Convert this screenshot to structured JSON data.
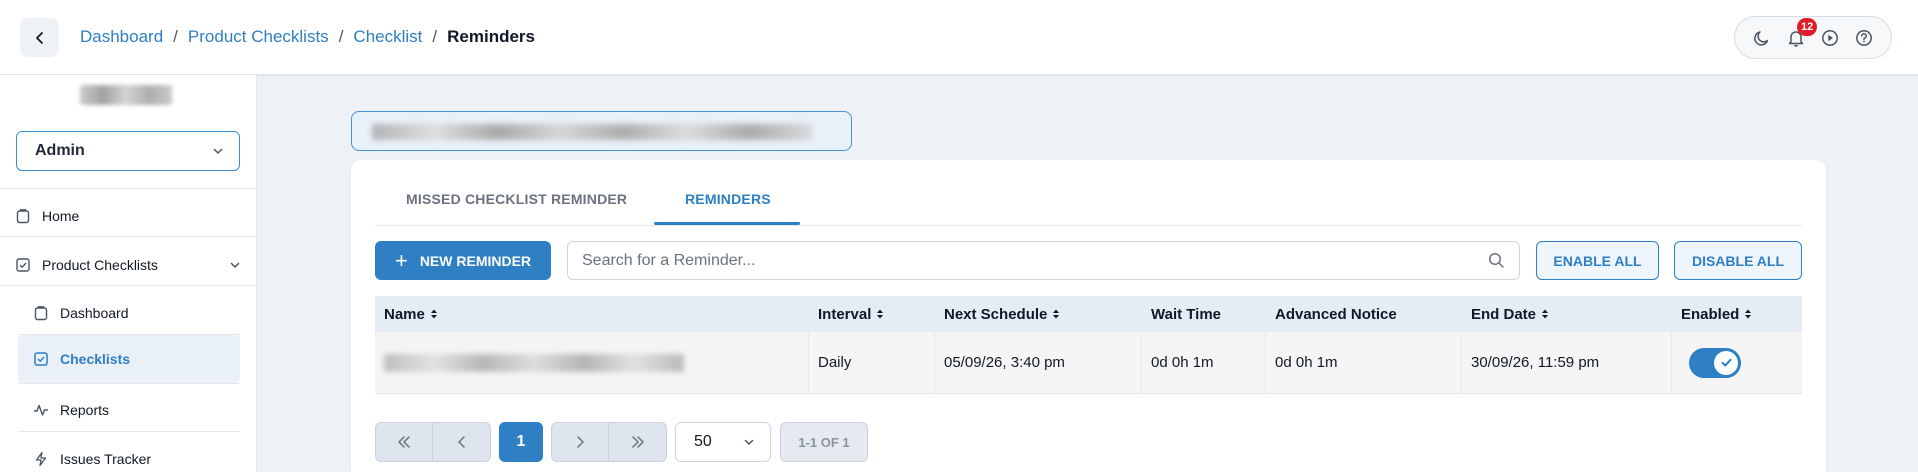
{
  "header": {
    "breadcrumb": {
      "items": [
        "Dashboard",
        "Product Checklists",
        "Checklist"
      ],
      "separator": "/",
      "current": "Reminders"
    },
    "notifications_count": "12",
    "tools": [
      "moon-icon",
      "bell-icon",
      "play-icon",
      "help-icon"
    ]
  },
  "sidebar": {
    "role": "Admin",
    "nav": {
      "home": "Home",
      "product_checklists": "Product Checklists",
      "dashboard": "Dashboard",
      "checklists": "Checklists",
      "reports": "Reports",
      "issues_tracker": "Issues Tracker"
    }
  },
  "main": {
    "tabs": {
      "missed": "MISSED CHECKLIST REMINDER",
      "reminders": "REMINDERS"
    },
    "toolbar": {
      "new_reminder": "NEW REMINDER",
      "search_placeholder": "Search for a Reminder...",
      "enable_all": "ENABLE ALL",
      "disable_all": "DISABLE ALL"
    },
    "table": {
      "columns": {
        "name": "Name",
        "interval": "Interval",
        "next_schedule": "Next Schedule",
        "wait_time": "Wait Time",
        "advanced_notice": "Advanced Notice",
        "end_date": "End Date",
        "enabled": "Enabled"
      },
      "rows": [
        {
          "interval": "Daily",
          "next_schedule": "05/09/26, 3:40 pm",
          "wait_time": "0d 0h 1m",
          "advanced_notice": "0d 0h 1m",
          "end_date": "30/09/26, 11:59 pm",
          "enabled": true
        }
      ]
    },
    "pagination": {
      "current_page": "1",
      "page_size": "50",
      "range": "1-1 OF 1"
    }
  },
  "colors": {
    "accent": "#2e7fc3",
    "badge": "#e11d2a",
    "background": "#eef1f5"
  }
}
